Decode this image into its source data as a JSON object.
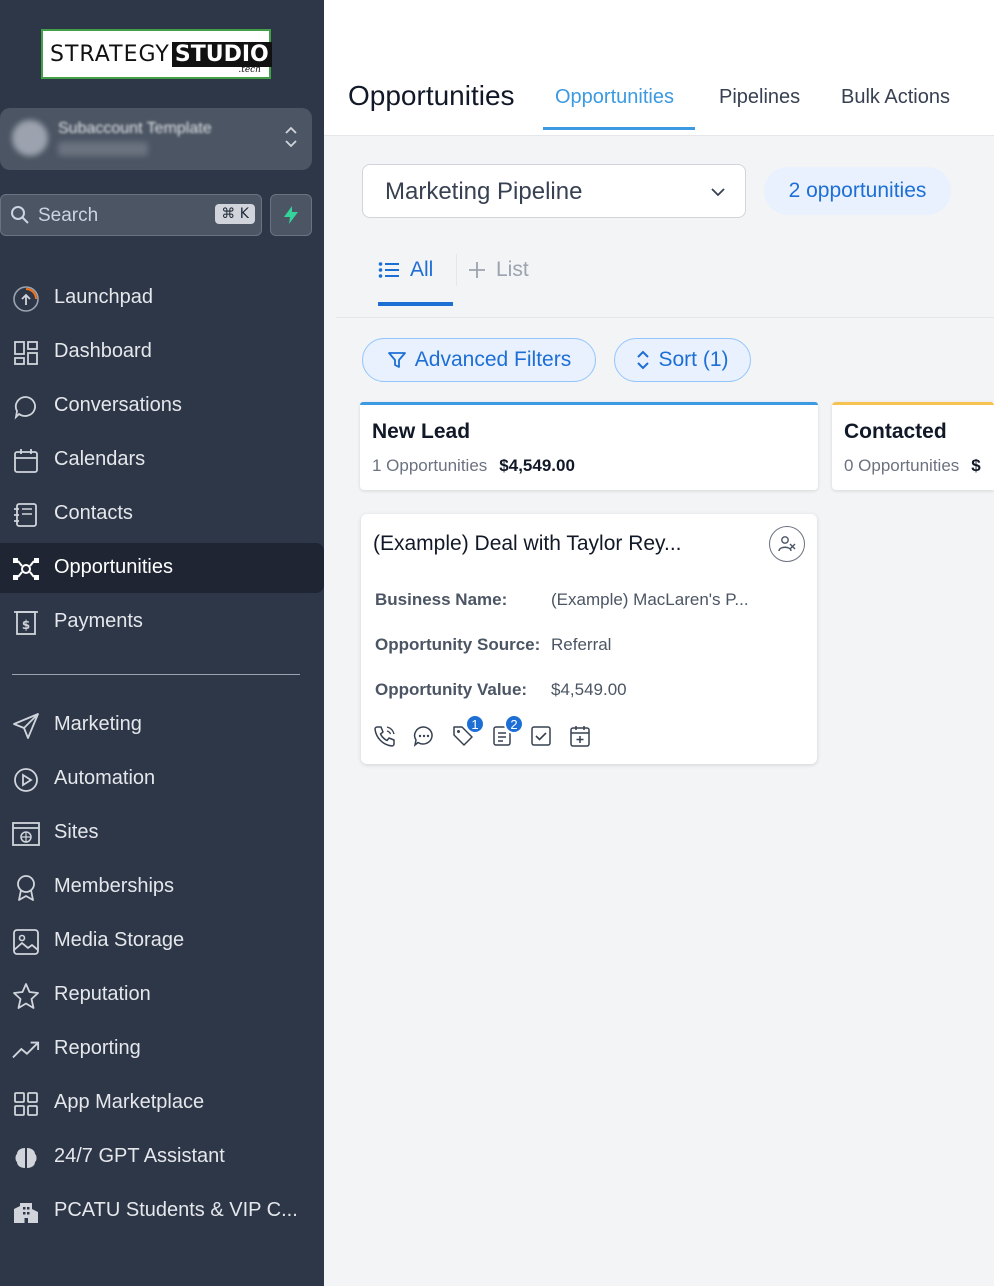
{
  "logo": {
    "part1": "STRATEGY",
    "part2": "STUDIO",
    "part3": ".tech"
  },
  "account": {
    "name": "Subaccount Template"
  },
  "search": {
    "placeholder": "Search",
    "shortcut": "⌘ K"
  },
  "sidebar": {
    "items": [
      {
        "label": "Launchpad",
        "icon": "launchpad-icon"
      },
      {
        "label": "Dashboard",
        "icon": "dashboard-icon"
      },
      {
        "label": "Conversations",
        "icon": "chat-icon"
      },
      {
        "label": "Calendars",
        "icon": "calendar-icon"
      },
      {
        "label": "Contacts",
        "icon": "contacts-icon"
      },
      {
        "label": "Opportunities",
        "icon": "opportunities-icon",
        "active": true
      },
      {
        "label": "Payments",
        "icon": "payments-icon"
      },
      {
        "label": "Marketing",
        "icon": "send-icon"
      },
      {
        "label": "Automation",
        "icon": "automation-icon"
      },
      {
        "label": "Sites",
        "icon": "sites-icon"
      },
      {
        "label": "Memberships",
        "icon": "badge-icon"
      },
      {
        "label": "Media Storage",
        "icon": "image-icon"
      },
      {
        "label": "Reputation",
        "icon": "star-icon"
      },
      {
        "label": "Reporting",
        "icon": "trend-icon"
      },
      {
        "label": "App Marketplace",
        "icon": "apps-icon"
      },
      {
        "label": "24/7 GPT Assistant",
        "icon": "brain-icon"
      },
      {
        "label": "PCATU Students & VIP C...",
        "icon": "building-icon"
      }
    ]
  },
  "header": {
    "title": "Opportunities",
    "tabs": [
      {
        "label": "Opportunities",
        "active": true
      },
      {
        "label": "Pipelines"
      },
      {
        "label": "Bulk Actions"
      }
    ]
  },
  "pipeline": {
    "selected": "Marketing Pipeline",
    "count_label": "2 opportunities"
  },
  "views": {
    "all": "All",
    "list": "List"
  },
  "filters": {
    "advanced": "Advanced Filters",
    "sort": "Sort (1)"
  },
  "stages": [
    {
      "title": "New Lead",
      "count": "1 Opportunities",
      "value": "$4,549.00",
      "color": "#3b9ae1"
    },
    {
      "title": "Contacted",
      "count": "0 Opportunities",
      "value": "$",
      "color": "#f6c350"
    }
  ],
  "card": {
    "title": "(Example) Deal with Taylor Rey...",
    "fields": [
      {
        "key": "Business Name:",
        "value": "(Example) MacLaren's P..."
      },
      {
        "key": "Opportunity Source:",
        "value": "Referral"
      },
      {
        "key": "Opportunity Value:",
        "value": "$4,549.00"
      }
    ],
    "badges": {
      "tags": "1",
      "notes": "2"
    }
  },
  "colors": {
    "sidebar_bg": "#2d3748",
    "accent": "#1d6fd6",
    "tab_active": "#3b9ae1"
  }
}
